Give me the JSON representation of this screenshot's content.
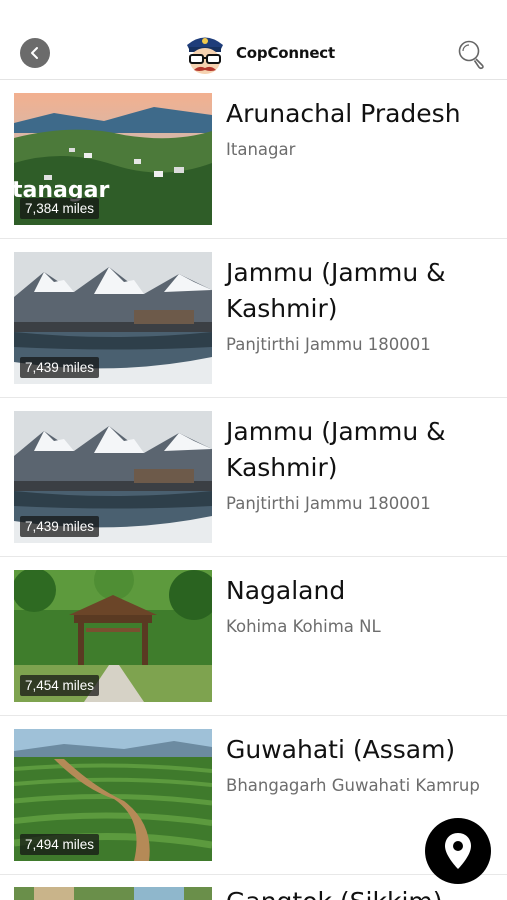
{
  "app": {
    "name": "CopConnect"
  },
  "header": {
    "back_icon": "back-arrow-icon",
    "logo_icon": "police-officer-logo-icon",
    "search_icon": "search-icon"
  },
  "locations": [
    {
      "title": "Arunachal Pradesh",
      "subtitle": "Itanagar",
      "distance": "7,384 miles",
      "thumb_overlay": "tanagar",
      "image": "arunachal-landscape"
    },
    {
      "title": "Jammu (Jammu & Kashmir)",
      "subtitle": "Panjtirthi Jammu 180001",
      "distance": "7,439 miles",
      "image": "snowy-mountains"
    },
    {
      "title": "Jammu (Jammu & Kashmir)",
      "subtitle": "Panjtirthi Jammu 180001",
      "distance": "7,439 miles",
      "image": "snowy-mountains"
    },
    {
      "title": "Nagaland",
      "subtitle": "Kohima Kohima NL",
      "distance": "7,454 miles",
      "image": "nagaland-gate"
    },
    {
      "title": "Guwahati (Assam)",
      "subtitle": "Bhangagarh Guwahati Kamrup",
      "distance": "7,494 miles",
      "image": "tea-garden"
    }
  ],
  "partial_item": {
    "title": "Gangtok (Sikkim)"
  },
  "fab": {
    "icon": "map-pin-icon"
  }
}
